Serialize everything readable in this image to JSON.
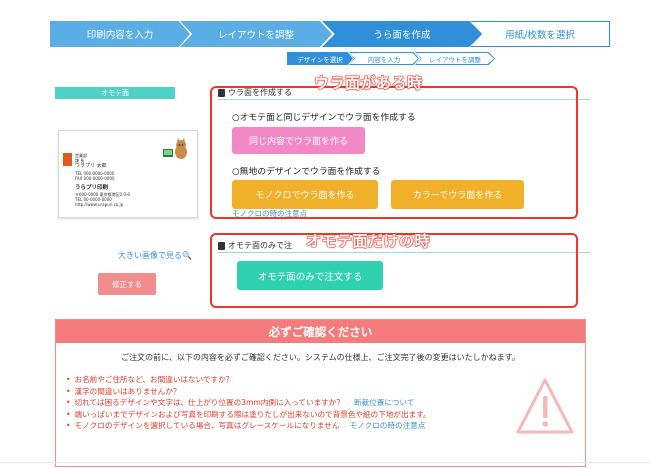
{
  "steps": [
    {
      "label": "印刷内容を入力"
    },
    {
      "label": "レイアウトを調整"
    },
    {
      "label": "うら面を作成"
    },
    {
      "label": "用紙/枚数を選択"
    }
  ],
  "substeps": [
    {
      "label": "デザインを選択"
    },
    {
      "label": "内容を入力"
    },
    {
      "label": "レイアウトを調整"
    }
  ],
  "front": {
    "label": "オモテ面",
    "card": {
      "title_small": "営業部",
      "title_small2": "課 長",
      "name_kana": "ウラプリ 太郎",
      "tel": "TEL 000-0000-0000",
      "fax": "FAX 000-0000-0000",
      "company": "うらプリ印刷",
      "addr1": "〒000-0000 東京都港区0-0-0",
      "addr2": "TEL 00-0000-0000",
      "addr3": "http://www.urapuri.co.jp"
    },
    "large_image_link": "大きい画像で見る",
    "fix_button": "修正する"
  },
  "back_section": {
    "head": "ウラ面を作成する",
    "option_same_title": "○オモテ面と同じデザインでウラ面を作成する",
    "same_button": "同じ内容でウラ面を作る",
    "option_plain_title": "○無地のデザインでウラ面を作成する",
    "mono_button": "モノクロでウラ面を作る",
    "color_button": "カラーでウラ面を作る",
    "mono_note": "モノクロの時の注意点",
    "annotation": "ウラ面がある時"
  },
  "front_only_section": {
    "head": "オモテ面のみで注",
    "button": "オモテ面のみで注文する",
    "annotation": "オモテ面だけの時"
  },
  "confirm": {
    "title": "必ずご確認ください",
    "intro": "ご注文の前に、以下の内容を必ずご確認ください。システムの仕様上、ご注文完了後の変更はいたしかねます。",
    "items": [
      {
        "text": "お名前やご住所など、お間違いはないですか？",
        "link": ""
      },
      {
        "text": "漢字の間違いはありませんか？",
        "link": ""
      },
      {
        "text": "切れては困るデザインや文字は、仕上がり位置の3mm内側に入っていますか？",
        "link": "断裁位置について"
      },
      {
        "text": "端いっぱいまでデザインおよび写真を印刷する際は塗りたしが出来ないので背景色や紙の下地が出ます。",
        "link": ""
      },
      {
        "text": "モノクロのデザインを選択している場合、写真はグレースケールになりません",
        "link": "モノクロの時の注意点"
      }
    ]
  },
  "colors": {
    "step_blue": "#5aaee3",
    "step_active": "#2f8fd8",
    "teal": "#4fd1c5",
    "pink": "#f189c7",
    "orange": "#f0b02a",
    "green_button": "#2fd1b1",
    "annotation_red": "#e8392c",
    "confirm_header": "#f47c7c"
  }
}
